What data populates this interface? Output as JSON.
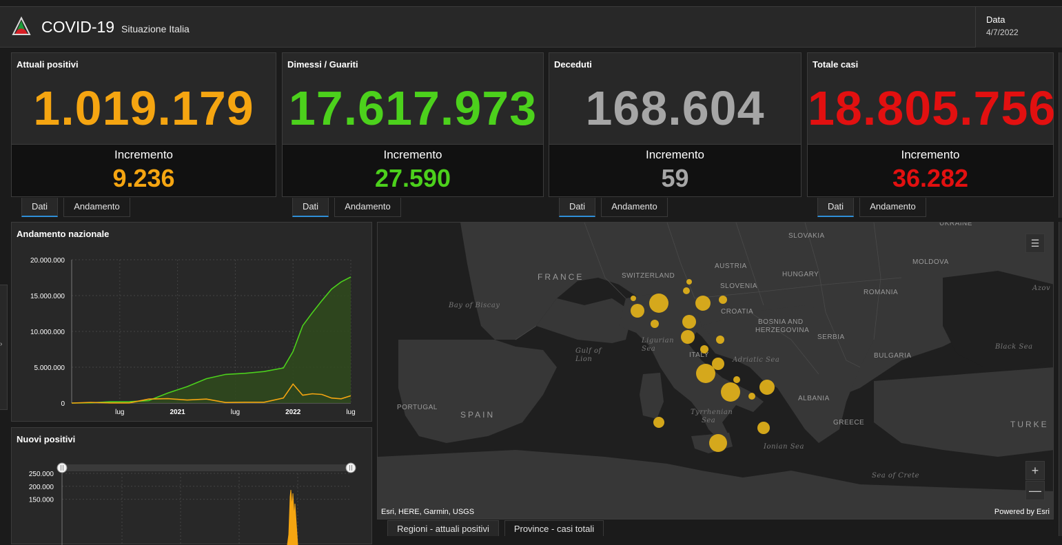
{
  "app": {
    "title": "COVID-19",
    "subtitle": "Situazione Italia",
    "date_label": "Data",
    "date_value": "4/7/2022"
  },
  "cards": [
    {
      "title": "Attuali positivi",
      "value": "1.019.179",
      "inc_label": "Incremento",
      "inc_value": "9.236",
      "color": "#f5a511"
    },
    {
      "title": "Dimessi / Guariti",
      "value": "17.617.973",
      "inc_label": "Incremento",
      "inc_value": "27.590",
      "color": "#4cd11c"
    },
    {
      "title": "Deceduti",
      "value": "168.604",
      "inc_label": "Incremento",
      "inc_value": "59",
      "color": "#a6a6a6"
    },
    {
      "title": "Totale casi",
      "value": "18.805.756",
      "inc_label": "Incremento",
      "inc_value": "36.282",
      "color": "#e21010"
    }
  ],
  "card_tabs": {
    "dati": "Dati",
    "andamento": "Andamento"
  },
  "trend_panel": {
    "title": "Andamento nazionale"
  },
  "new_panel": {
    "title": "Nuovi positivi"
  },
  "chart_data": [
    {
      "type": "area",
      "title": "Andamento nazionale",
      "y_ticks": [
        "20.000.000",
        "15.000.000",
        "10.000.000",
        "5.000.000",
        "0"
      ],
      "x_ticks": [
        "lug",
        "2021",
        "lug",
        "2022",
        "lug"
      ],
      "ylim": [
        0,
        20000000
      ],
      "x_months": [
        "2020-02",
        "2020-04",
        "2020-06",
        "2020-08",
        "2020-10",
        "2020-12",
        "2021-02",
        "2021-04",
        "2021-06",
        "2021-08",
        "2021-10",
        "2021-12",
        "2022-01",
        "2022-02",
        "2022-03",
        "2022-04",
        "2022-05",
        "2022-06",
        "2022-07"
      ],
      "series": [
        {
          "values": [
            0,
            30000,
            180000,
            200000,
            350000,
            1400000,
            2300000,
            3400000,
            4000000,
            4150000,
            4400000,
            4900000,
            7200000,
            10800000,
            12600000,
            14300000,
            15900000,
            16900000,
            17600000
          ],
          "color": "#4cd11c"
        },
        {
          "values": [
            0,
            100000,
            20000,
            15000,
            560000,
            620000,
            420000,
            560000,
            80000,
            120000,
            120000,
            700000,
            2650000,
            1100000,
            1300000,
            1200000,
            700000,
            600000,
            1020000
          ],
          "color": "#f5a511"
        }
      ]
    },
    {
      "type": "line",
      "title": "Nuovi positivi",
      "y_ticks": [
        "250.000",
        "200.000",
        "150.000"
      ],
      "ylim": [
        0,
        250000
      ],
      "series": [
        {
          "color": "#f5a511"
        }
      ]
    }
  ],
  "map": {
    "labels": [
      "FRANCE",
      "SWITZERLAND",
      "AUSTRIA",
      "SLOVAKIA",
      "HUNGARY",
      "SLOVENIA",
      "CROATIA",
      "BOSNIA AND",
      "HERZEGOVINA",
      "SERBIA",
      "ROMANIA",
      "MOLDOVA",
      "UKRAINE",
      "BULGARIA",
      "ITALY",
      "ALBANIA",
      "GREECE",
      "PORTUGAL",
      "SPAIN",
      "TURKE"
    ],
    "sea_labels": [
      "Bay of Biscay",
      "Gulf of",
      "Lion",
      "Ligurian",
      "Sea",
      "Adriatic Sea",
      "Tyrrhenian",
      "Sea",
      "Ionian Sea",
      "Black Sea",
      "Sea of Crete",
      "Azov S"
    ],
    "attribution": "Esri, HERE, Garmin, USGS",
    "powered": "Powered by Esri",
    "zoom_in": "+",
    "zoom_out": "—",
    "bubble_color": "#e3b21a"
  },
  "map_tabs": {
    "regioni": "Regioni - attuali positivi",
    "province": "Province - casi totali"
  }
}
